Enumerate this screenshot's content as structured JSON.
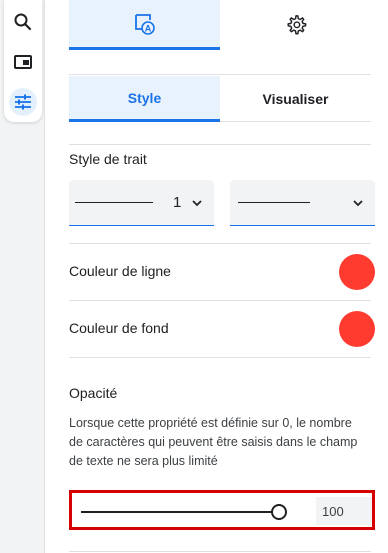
{
  "toolbar": {
    "items": [
      {
        "icon": "search-icon",
        "active": false
      },
      {
        "icon": "picture-in-picture-icon",
        "active": false
      },
      {
        "icon": "tune-sliders-icon",
        "active": true
      }
    ]
  },
  "top_tabs": [
    {
      "icon": "draw-annotation-icon",
      "active": true
    },
    {
      "icon": "settings-gear-icon",
      "active": false
    }
  ],
  "sub_tabs": {
    "style_label": "Style",
    "visualiser_label": "Visualiser"
  },
  "stroke": {
    "label": "Style de trait",
    "width_value": "1"
  },
  "line_color": {
    "label": "Couleur de ligne",
    "color": "#ff3b30"
  },
  "fill_color": {
    "label": "Couleur de fond",
    "color": "#ff3b30"
  },
  "opacity": {
    "label": "Opacité",
    "description": "Lorsque cette propriété est définie sur 0, le nombre de caractères qui peuvent être saisis dans le champ de texte ne sera plus limité",
    "value": "100",
    "level": 1.0
  },
  "colors": {
    "accent": "#1a73e8",
    "highlight_border": "#d60000"
  }
}
